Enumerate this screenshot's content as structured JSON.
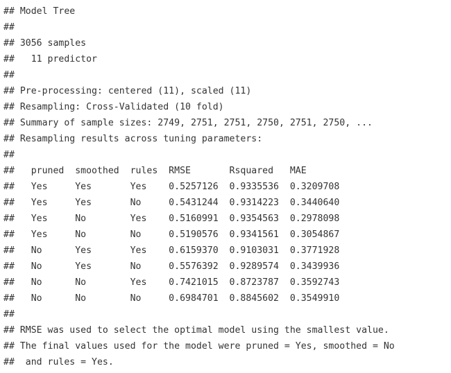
{
  "console": {
    "lines": [
      "## Model Tree",
      "##",
      "## 3056 samples",
      "##   11 predictor",
      "##",
      "## Pre-processing: centered (11), scaled (11)",
      "## Resampling: Cross-Validated (10 fold)",
      "## Summary of sample sizes: 2749, 2751, 2751, 2750, 2751, 2750, ...",
      "## Resampling results across tuning parameters:",
      "##",
      "##   pruned  smoothed  rules  RMSE       Rsquared   MAE",
      "##   Yes     Yes       Yes    0.5257126  0.9335536  0.3209708",
      "##   Yes     Yes       No     0.5431244  0.9314223  0.3440640",
      "##   Yes     No        Yes    0.5160991  0.9354563  0.2978098",
      "##   Yes     No        No     0.5190576  0.9341561  0.3054867",
      "##   No      Yes       Yes    0.6159370  0.9103031  0.3771928",
      "##   No      Yes       No     0.5576392  0.9289574  0.3439936",
      "##   No      No        Yes    0.7421015  0.8723787  0.3592743",
      "##   No      No        No     0.6984701  0.8845602  0.3549910",
      "##",
      "## RMSE was used to select the optimal model using the smallest value.",
      "## The final values used for the model were pruned = Yes, smoothed = No",
      "##  and rules = Yes."
    ]
  }
}
